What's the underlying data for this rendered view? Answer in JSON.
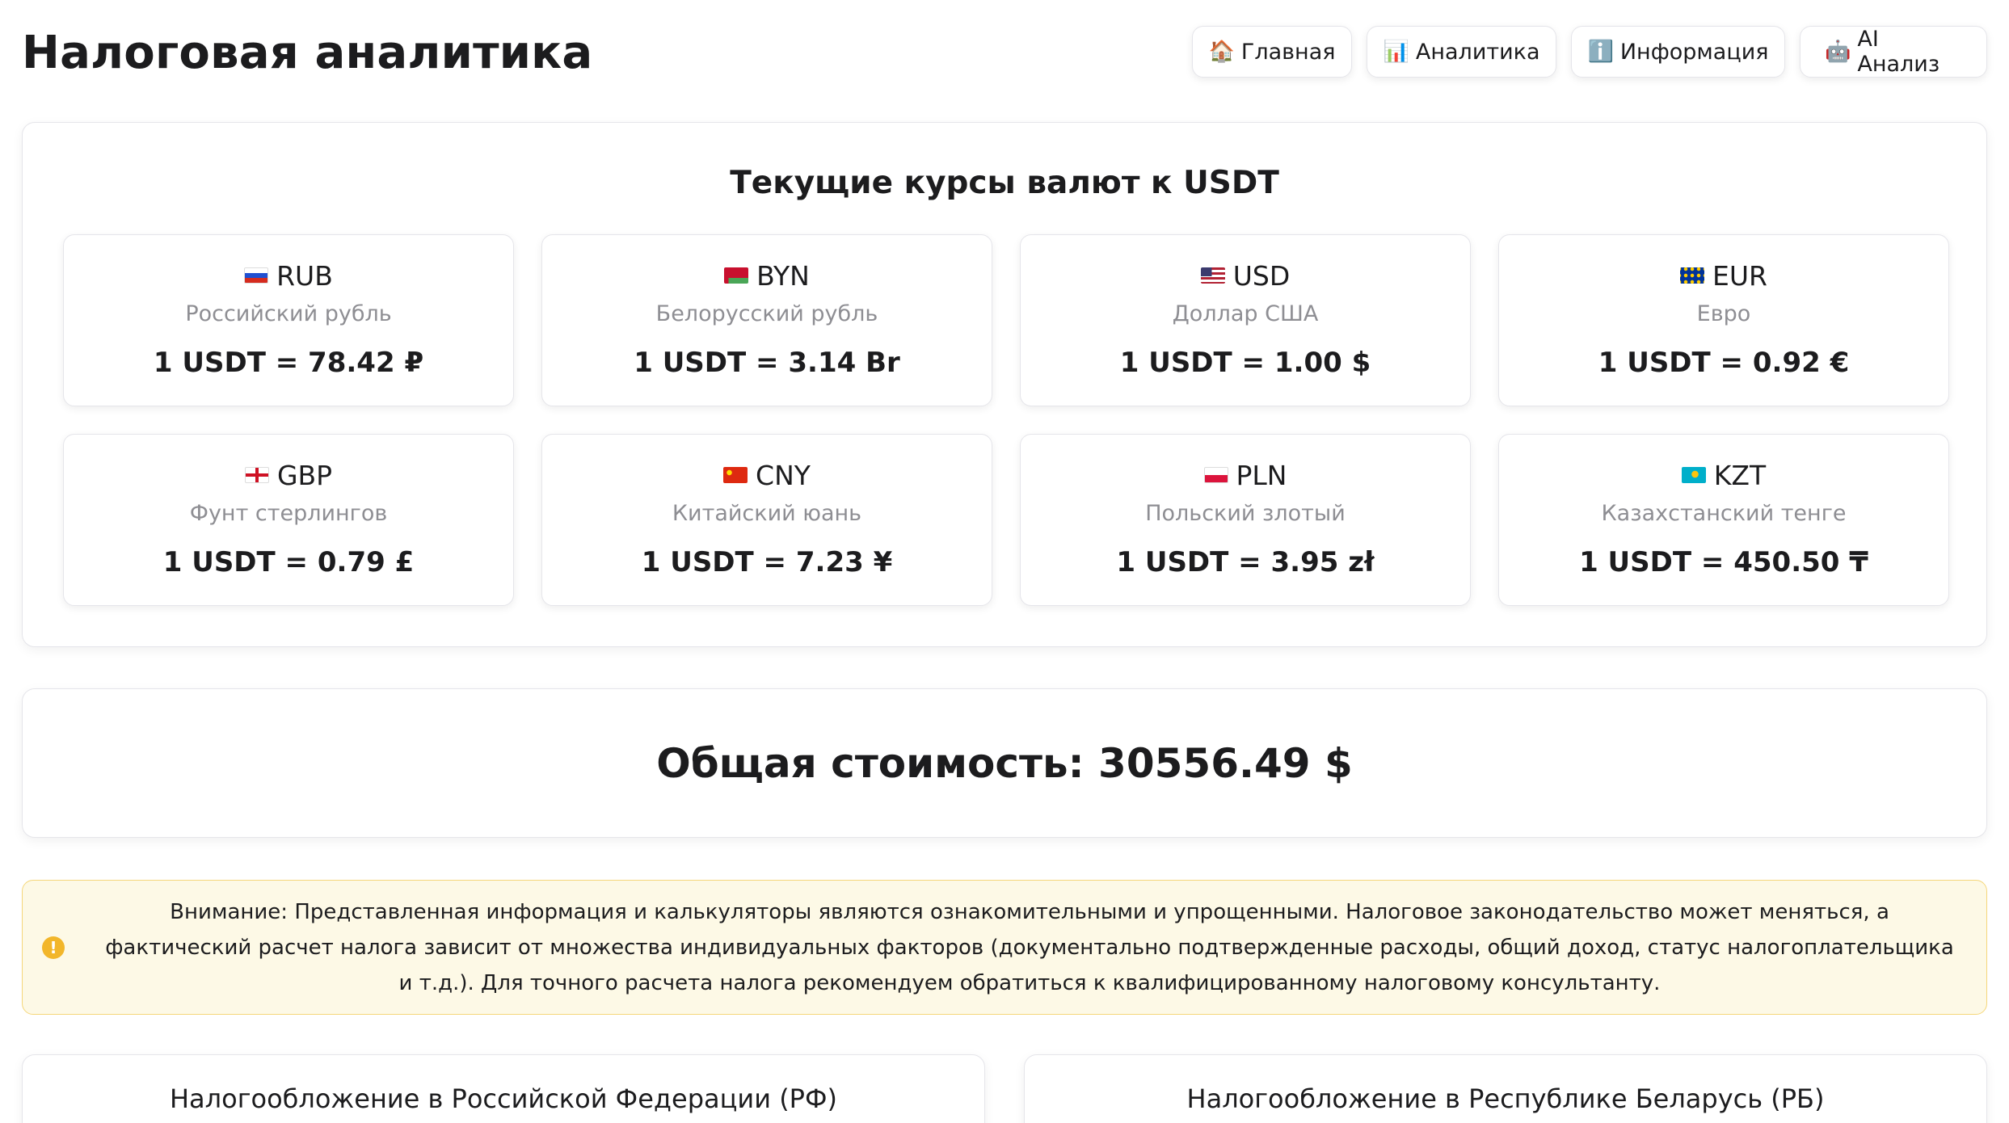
{
  "header": {
    "title": "Налоговая аналитика",
    "nav": [
      {
        "icon": "🏠",
        "label": "Главная",
        "icon_name": "house-icon"
      },
      {
        "icon": "📊",
        "label": "Аналитика",
        "icon_name": "bar-chart-icon"
      },
      {
        "icon": "ℹ️",
        "label": "Информация",
        "icon_name": "info-icon"
      },
      {
        "icon": "🤖",
        "label": "AI Анализ",
        "icon_name": "robot-icon"
      }
    ]
  },
  "rates": {
    "title": "Текущие курсы валют к USDT",
    "items": [
      {
        "code": "RUB",
        "name": "Российский рубль",
        "value": "1 USDT = 78.42 ₽"
      },
      {
        "code": "BYN",
        "name": "Белорусский рубль",
        "value": "1 USDT = 3.14 Br"
      },
      {
        "code": "USD",
        "name": "Доллар США",
        "value": "1 USDT = 1.00 $"
      },
      {
        "code": "EUR",
        "name": "Евро",
        "value": "1 USDT = 0.92 €"
      },
      {
        "code": "GBP",
        "name": "Фунт стерлингов",
        "value": "1 USDT = 0.79 £"
      },
      {
        "code": "CNY",
        "name": "Китайский юань",
        "value": "1 USDT = 7.23 ¥"
      },
      {
        "code": "PLN",
        "name": "Польский злотый",
        "value": "1 USDT = 3.95 zł"
      },
      {
        "code": "KZT",
        "name": "Казахстанский тенге",
        "value": "1 USDT = 450.50 ₸"
      }
    ]
  },
  "total": {
    "text": "Общая стоимость: 30556.49 $"
  },
  "warning": {
    "icon_name": "warning-icon",
    "icon": "!",
    "label": "Внимание:",
    "text": "Представленная информация и калькуляторы являются ознакомительными и упрощенными. Налоговое законодательство может меняться, а фактический расчет налога зависит от множества индивидуальных факторов (документально подтвержденные расходы, общий доход, статус налогоплательщика и т.д.). Для точного расчета налога рекомендуем обратиться к квалифицированному налоговому консультанту."
  },
  "tax_sections": {
    "ru_title": "Налогообложение в Российской Федерации (РФ)",
    "by_title": "Налогообложение в Республике Беларусь (РБ)"
  }
}
